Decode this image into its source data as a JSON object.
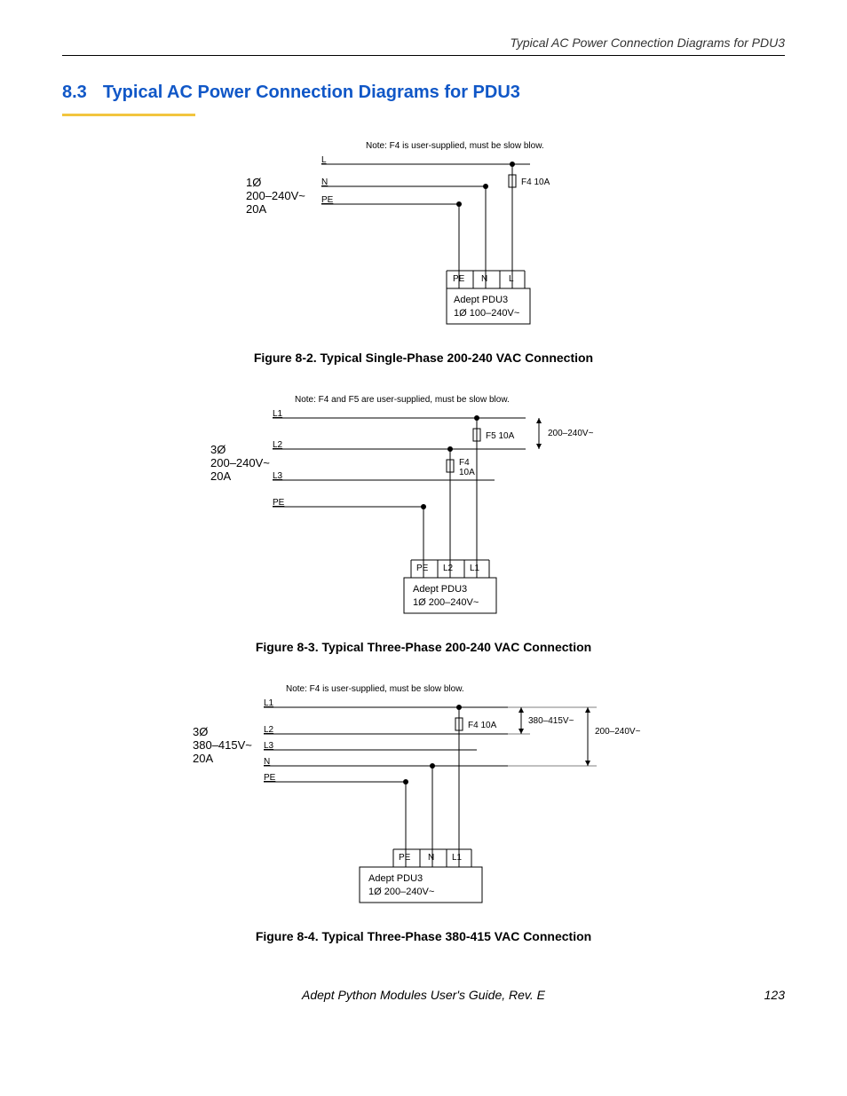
{
  "header": {
    "running": "Typical AC Power Connection Diagrams for PDU3"
  },
  "section": {
    "number": "8.3",
    "title": "Typical AC Power Connection Diagrams for PDU3"
  },
  "figures": {
    "f1": {
      "note": "Note: F4 is user-supplied, must be slow blow.",
      "supply_line1": "1Ø",
      "supply_line2": "200–240V~",
      "supply_line3": "20A",
      "wires": {
        "L": "L",
        "N": "N",
        "PE": "PE"
      },
      "fuse": "F4 10A",
      "terminals": {
        "PE": "PE",
        "N": "N",
        "L": "L"
      },
      "box_line1": "Adept PDU3",
      "box_line2": "1Ø 100–240V~",
      "caption": "Figure 8-2. Typical Single-Phase 200-240 VAC Connection"
    },
    "f2": {
      "note": "Note: F4 and F5 are user-supplied, must be slow blow.",
      "supply_line1": "3Ø",
      "supply_line2": "200–240V~",
      "supply_line3": "20A",
      "wires": {
        "L1": "L1",
        "L2": "L2",
        "L3": "L3",
        "PE": "PE"
      },
      "fuseA": "F5 10A",
      "fuseB_line1": "F4",
      "fuseB_line2": "10A",
      "arrow_label": "200–240V~",
      "terminals": {
        "PE": "PE",
        "L2": "L2",
        "L1": "L1"
      },
      "box_line1": "Adept PDU3",
      "box_line2": "1Ø 200–240V~",
      "caption": "Figure 8-3. Typical Three-Phase 200-240 VAC Connection"
    },
    "f3": {
      "note": "Note: F4 is user-supplied, must be slow blow.",
      "supply_line1": "3Ø",
      "supply_line2": "380–415V~",
      "supply_line3": "20A",
      "wires": {
        "L1": "L1",
        "L2": "L2",
        "L3": "L3",
        "N": "N",
        "PE": "PE"
      },
      "fuse": "F4 10A",
      "arrow1_label": "380–415V~",
      "arrow2_label": "200–240V~",
      "terminals": {
        "PE": "PE",
        "N": "N",
        "L1": "L1"
      },
      "box_line1": "Adept PDU3",
      "box_line2": "1Ø 200–240V~",
      "caption": "Figure 8-4. Typical Three-Phase 380-415 VAC Connection"
    }
  },
  "footer": {
    "doc": "Adept Python Modules User's Guide, Rev. E",
    "page": "123"
  }
}
